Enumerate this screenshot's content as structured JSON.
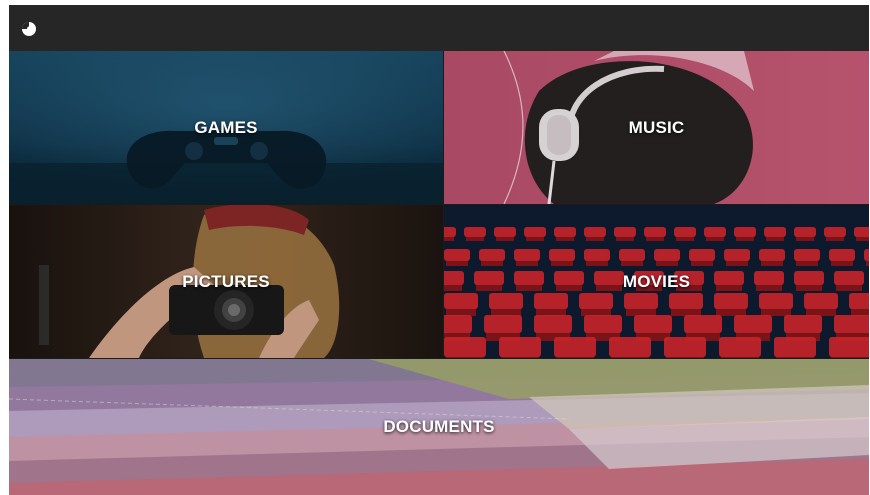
{
  "app": {
    "logo_icon": "circle-logo-icon"
  },
  "tiles": {
    "games": {
      "label": "GAMES"
    },
    "music": {
      "label": "MUSIC"
    },
    "pictures": {
      "label": "PICTURES"
    },
    "movies": {
      "label": "MOVIES"
    },
    "documents": {
      "label": "DOCUMENTS"
    }
  },
  "colors": {
    "topbar": "#262626",
    "games_bg": "#0f3449",
    "music_bg": "#b04663",
    "pictures_bg": "#2a1e17",
    "movies_bg": "#0d1a2e",
    "movies_seats": "#c9242a",
    "documents_bg": "#7a5f6f"
  }
}
